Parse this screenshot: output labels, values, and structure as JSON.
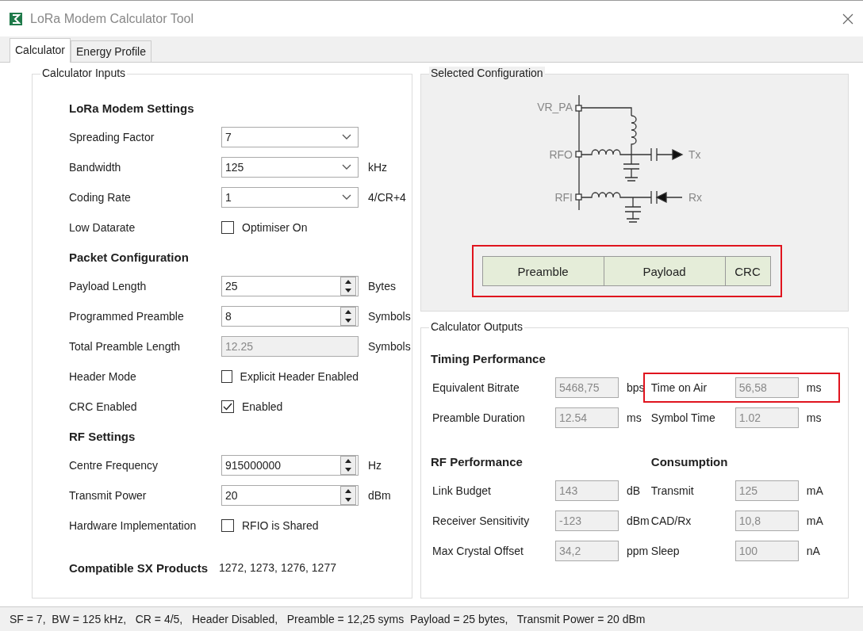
{
  "window": {
    "title": "LoRa Modem Calculator Tool"
  },
  "tabs": [
    {
      "label": "Calculator",
      "selected": true
    },
    {
      "label": "Energy Profile",
      "selected": false
    }
  ],
  "inputs": {
    "title": "Calculator Inputs",
    "sections": [
      {
        "heading": "LoRa Modem Settings",
        "rows": [
          {
            "kind": "dropdown",
            "label": "Spreading Factor",
            "value": "7"
          },
          {
            "kind": "dropdown",
            "label": "Bandwidth",
            "value": "125",
            "unit": "kHz"
          },
          {
            "kind": "dropdown",
            "label": "Coding Rate",
            "value": "1",
            "unit": "4/CR+4"
          },
          {
            "kind": "checkbox",
            "label": "Low Datarate",
            "option": "Optimiser On",
            "checked": false
          }
        ]
      },
      {
        "heading": "Packet Configuration",
        "rows": [
          {
            "kind": "spin",
            "label": "Payload Length",
            "value": "25",
            "unit": "Bytes"
          },
          {
            "kind": "spin",
            "label": "Programmed Preamble",
            "value": "8",
            "unit": "Symbols"
          },
          {
            "kind": "readonly",
            "label": "Total Preamble Length",
            "value": "12.25",
            "unit": "Symbols"
          },
          {
            "kind": "checkbox",
            "label": "Header Mode",
            "option": "Explicit Header Enabled",
            "checked": false
          },
          {
            "kind": "checkbox",
            "label": "CRC Enabled",
            "option": "Enabled",
            "checked": true
          }
        ]
      },
      {
        "heading": "RF Settings",
        "rows": [
          {
            "kind": "spin",
            "label": "Centre Frequency",
            "value": "915000000",
            "unit": "Hz"
          },
          {
            "kind": "spin",
            "label": "Transmit Power",
            "value": "20",
            "unit": "dBm"
          },
          {
            "kind": "checkbox",
            "label": "Hardware Implementation",
            "option": "RFIO is Shared",
            "checked": false
          }
        ]
      }
    ],
    "compatible": {
      "label": "Compatible SX Products",
      "value": "1272, 1273, 1276, 1277"
    }
  },
  "selected_configuration": {
    "title": "Selected Configuration",
    "circuit_labels": [
      "VR_PA",
      "RFO",
      "RFI",
      "Tx",
      "Rx"
    ],
    "packet": {
      "highlighted": true,
      "fields": [
        "Preamble",
        "Payload",
        "CRC"
      ]
    }
  },
  "outputs": {
    "title": "Calculator Outputs",
    "sections": [
      {
        "heading": "Timing Performance",
        "rows": [
          {
            "label": "Equivalent Bitrate",
            "value": "5468,75",
            "unit": "bps",
            "highlighted": false
          },
          {
            "label": "Preamble Duration",
            "value": "12.54",
            "unit": "ms",
            "highlighted": false
          }
        ]
      },
      {
        "rows": [
          {
            "label": "Time on Air",
            "value": "56,58",
            "unit": "ms",
            "highlighted": true
          },
          {
            "label": "Symbol Time",
            "value": "1.02",
            "unit": "ms",
            "highlighted": false
          }
        ]
      },
      {
        "heading": "RF Performance",
        "rows": [
          {
            "label": "Link Budget",
            "value": "143",
            "unit": "dB",
            "highlighted": false
          },
          {
            "label": "Receiver Sensitivity",
            "value": "-123",
            "unit": "dBm",
            "highlighted": false
          },
          {
            "label": "Max Crystal Offset",
            "value": "34,2",
            "unit": "ppm",
            "highlighted": false
          }
        ]
      },
      {
        "heading": "Consumption",
        "rows": [
          {
            "label": "Transmit",
            "value": "125",
            "unit": "mA",
            "highlighted": false
          },
          {
            "label": "CAD/Rx",
            "value": "10,8",
            "unit": "mA",
            "highlighted": false
          },
          {
            "label": "Sleep",
            "value": "100",
            "unit": "nA",
            "highlighted": false
          }
        ]
      }
    ]
  },
  "status_bar": {
    "text": "SF = 7,  BW = 125 kHz,   CR = 4/5,   Header Disabled,   Preamble = 12,25 syms  Payload = 25 bytes,   Transmit Power = 20 dBm"
  }
}
